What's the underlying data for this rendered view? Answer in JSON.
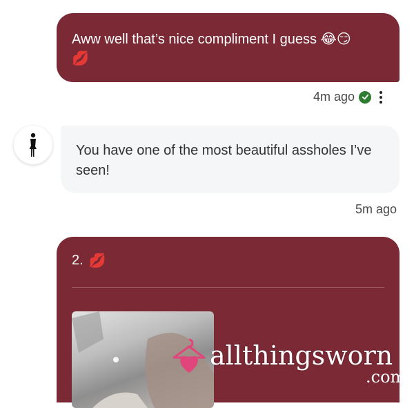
{
  "messages": {
    "outgoing_1": {
      "text": "Aww well that’s nice compliment I guess 😂😏",
      "emoji_line": "💋",
      "time": "4m ago",
      "status_icon": "check-circle-icon",
      "menu_icon": "kebab-menu-icon"
    },
    "incoming_1": {
      "avatar_icon": "person-silhouette-icon",
      "text": "You have one of the most beautiful assholes I’ve seen!",
      "time": "5m ago"
    },
    "outgoing_2": {
      "caption": "2.",
      "caption_emoji": "💋",
      "attachment_icon": "photo-thumbnail"
    }
  },
  "watermark": {
    "logo_icon": "hanger-heart-logo-icon",
    "text": "allthingsworn",
    "suffix": ".com"
  },
  "colors": {
    "outgoing_bubble": "#7a2935",
    "incoming_bubble": "#f5f6f8",
    "check_green": "#2e7d32",
    "watermark_pink": "#e0457b"
  }
}
